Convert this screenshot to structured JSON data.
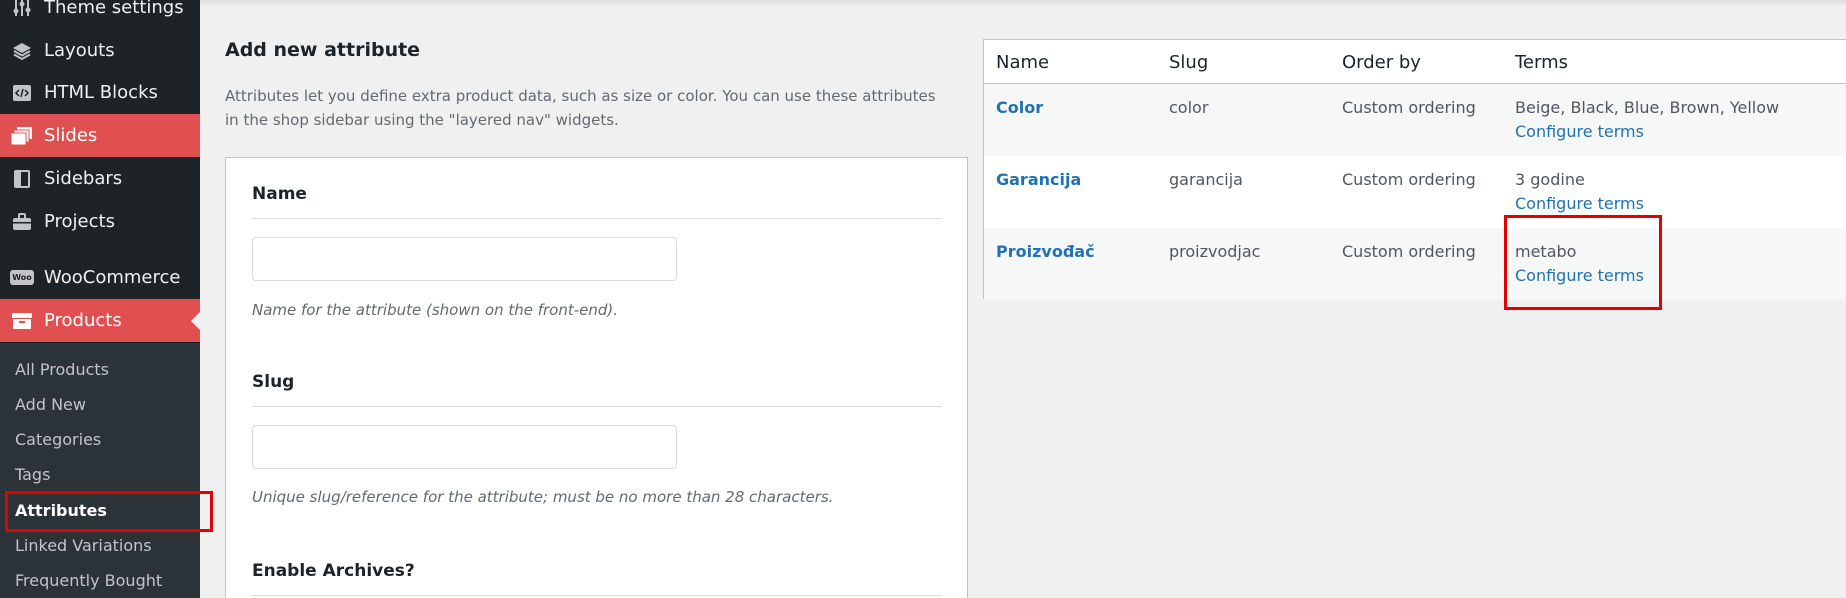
{
  "sidebar": {
    "items": [
      {
        "label": "Theme settings",
        "icon": "sliders-icon"
      },
      {
        "label": "Layouts",
        "icon": "layers-icon"
      },
      {
        "label": "HTML Blocks",
        "icon": "code-icon"
      },
      {
        "label": "Slides",
        "icon": "slides-icon"
      },
      {
        "label": "Sidebars",
        "icon": "sidebar-icon"
      },
      {
        "label": "Projects",
        "icon": "briefcase-icon"
      },
      {
        "label": "WooCommerce",
        "icon": "woo-icon",
        "icon_text": "Woo"
      },
      {
        "label": "Products",
        "icon": "archive-icon"
      }
    ],
    "submenu": [
      "All Products",
      "Add New",
      "Categories",
      "Tags",
      "Attributes",
      "Linked Variations",
      "Frequently Bought"
    ],
    "current_submenu": "Attributes"
  },
  "form": {
    "title": "Add new attribute",
    "description": "Attributes let you define extra product data, such as size or color. You can use these attributes in the shop sidebar using the \"layered nav\" widgets.",
    "name_label": "Name",
    "name_value": "",
    "name_help": "Name for the attribute (shown on the front-end).",
    "slug_label": "Slug",
    "slug_value": "",
    "slug_help": "Unique slug/reference for the attribute; must be no more than 28 characters.",
    "archives_label": "Enable Archives?"
  },
  "table": {
    "headers": [
      "Name",
      "Slug",
      "Order by",
      "Terms"
    ],
    "rows": [
      {
        "name": "Color",
        "slug": "color",
        "order_by": "Custom ordering",
        "terms": "Beige, Black, Blue, Brown, Yellow",
        "configure": "Configure terms"
      },
      {
        "name": "Garancija",
        "slug": "garancija",
        "order_by": "Custom ordering",
        "terms": "3 godine",
        "configure": "Configure terms"
      },
      {
        "name": "Proizvođač",
        "slug": "proizvodjac",
        "order_by": "Custom ordering",
        "terms": "metabo",
        "configure": "Configure terms"
      }
    ]
  },
  "colors": {
    "accent_red": "#e05050",
    "highlight_box": "#e00000",
    "link_blue": "#2271b1",
    "sidebar_bg": "#1d2327"
  }
}
